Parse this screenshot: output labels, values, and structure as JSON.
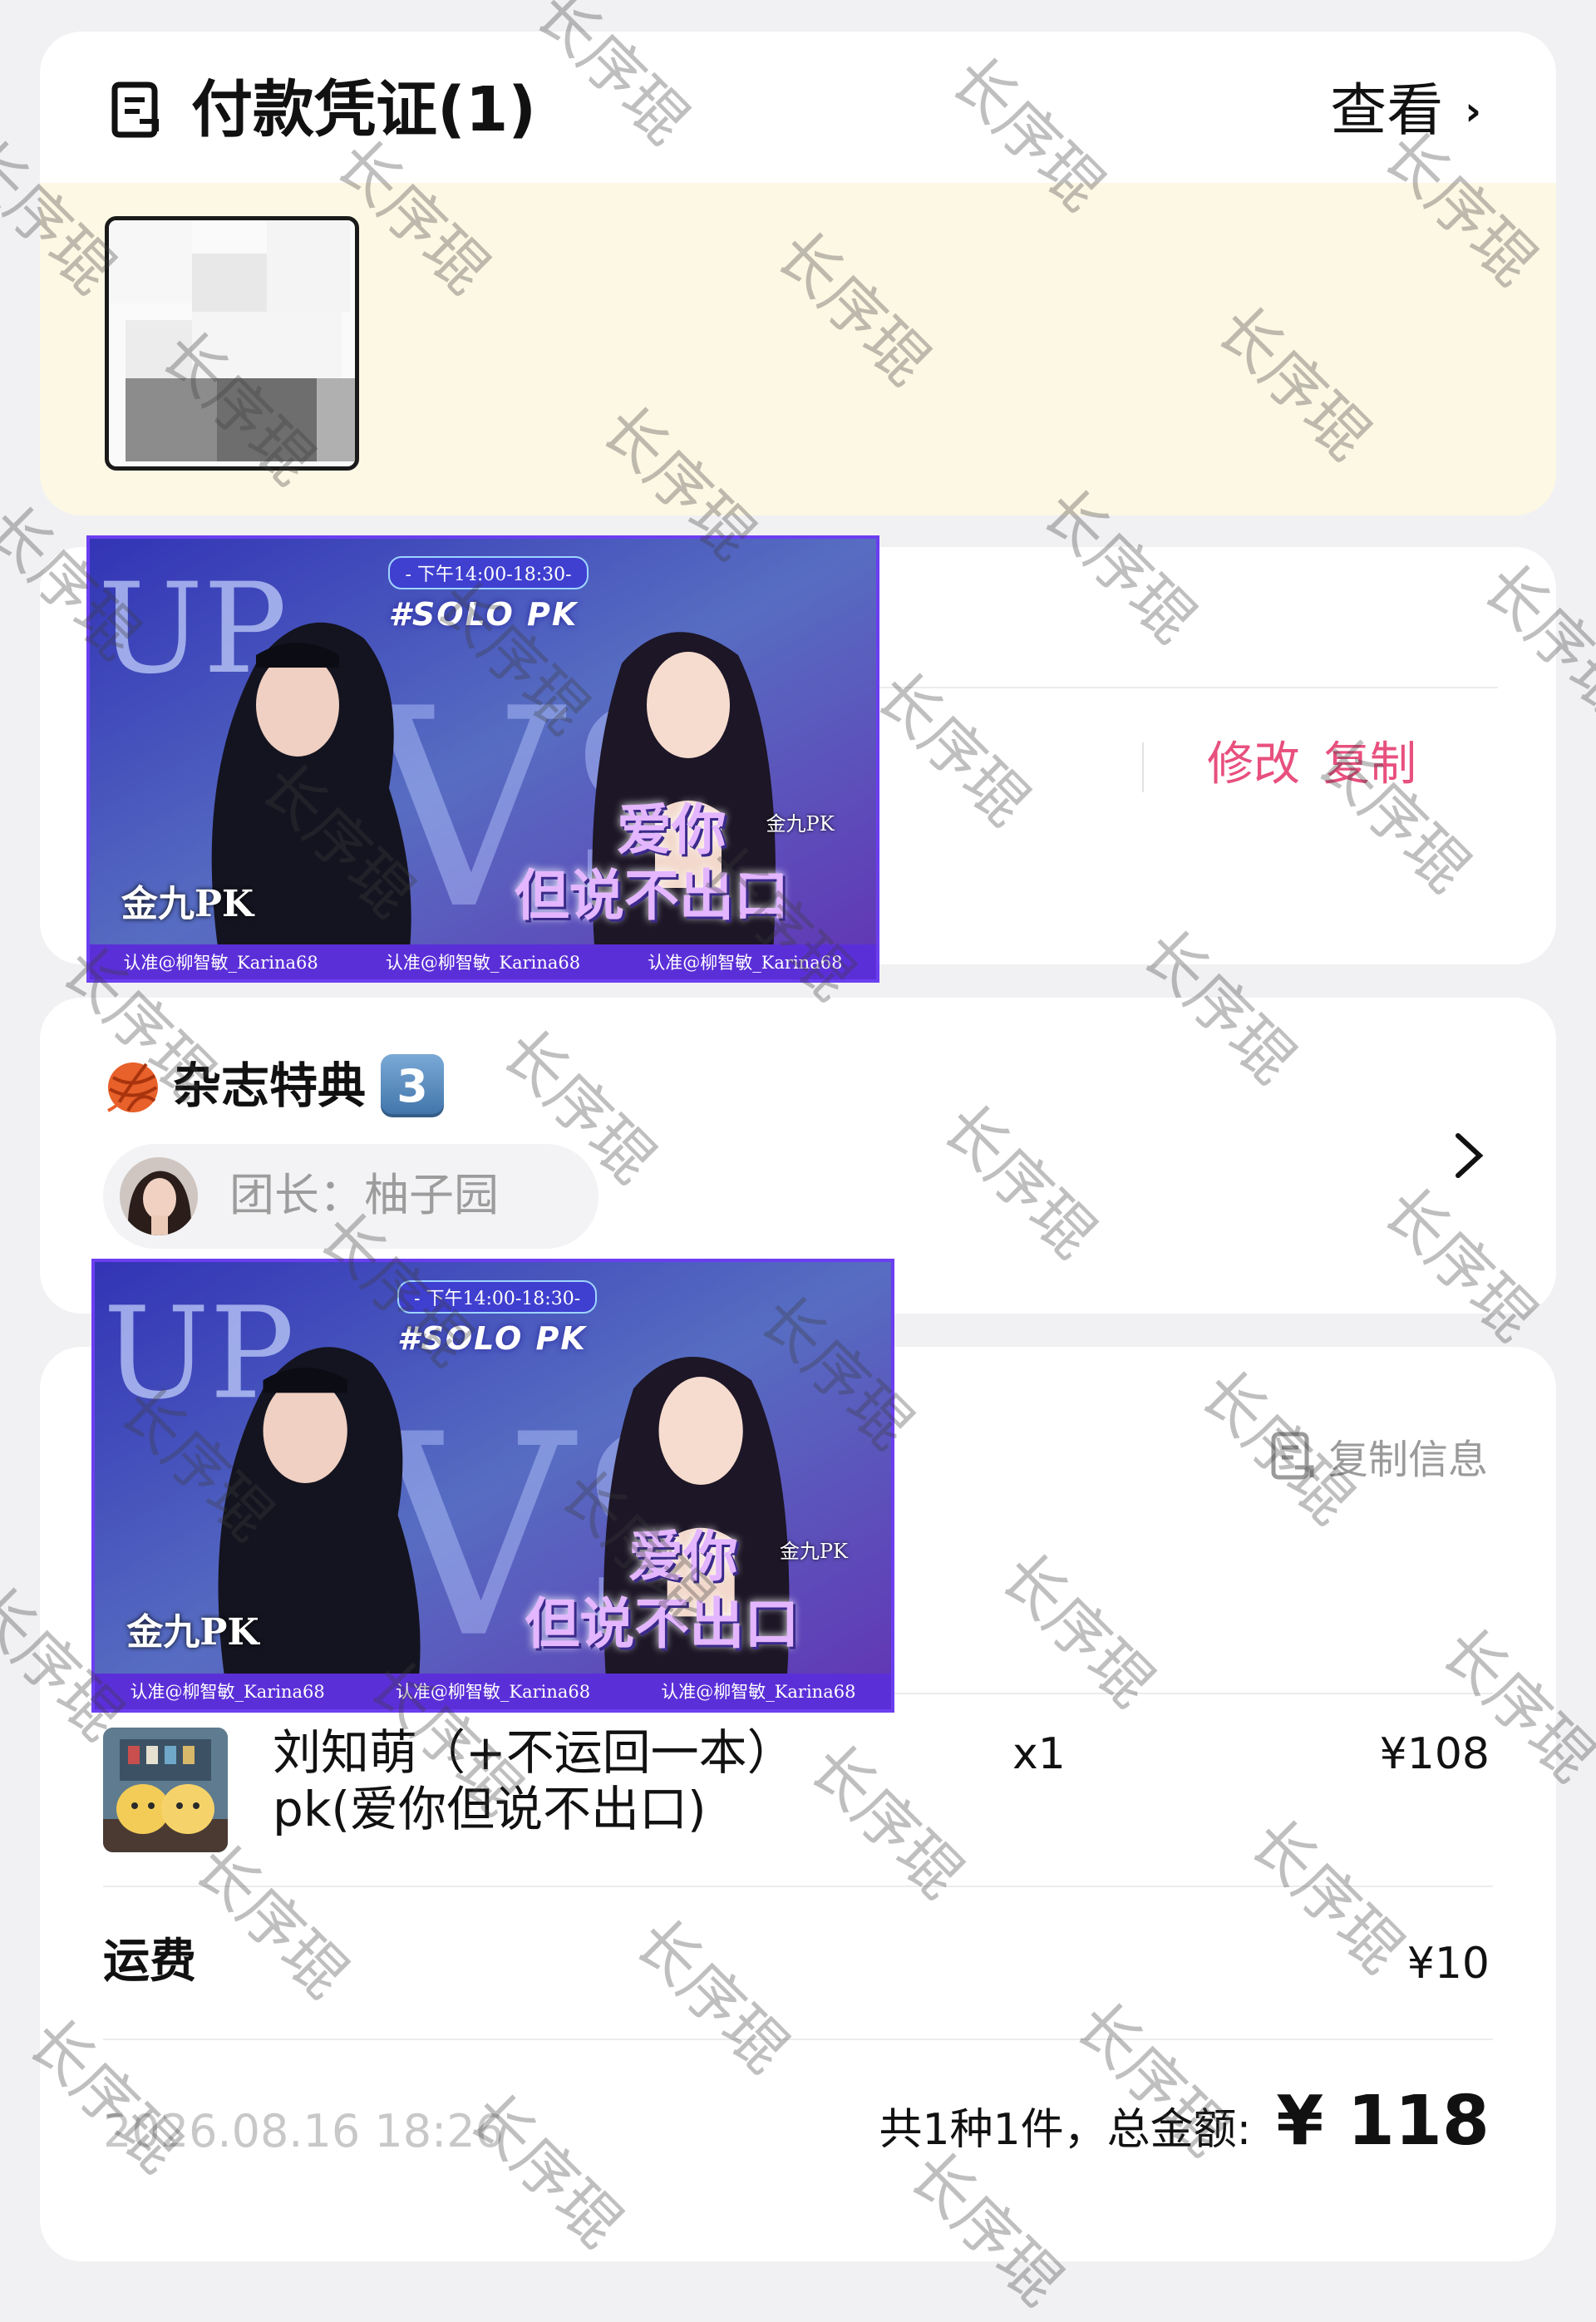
{
  "voucher": {
    "title": "付款凭证(1)",
    "view_label": "查看",
    "view_chevron": "›"
  },
  "address": {
    "edit_label": "修改",
    "copy_label": "复制"
  },
  "banner": {
    "time": "- 下午14:00-18:30-",
    "solo": "#SOLO PK",
    "left_title": "金九PK",
    "right_tag": "金九PK",
    "line1": "爱你",
    "line2": "但说不出口",
    "footer": [
      "认准@柳智敏_Karina68",
      "认准@柳智敏_Karina68",
      "认准@柳智敏_Karina68"
    ]
  },
  "group": {
    "title": "杂志特典",
    "badge": "3",
    "leader_text": "团长：柚子园"
  },
  "order": {
    "copy_info": "复制信息",
    "product_name": "刘知萌（+不运回一本）pk(爱你但说不出口)",
    "product_qty": "x1",
    "product_price": "¥108",
    "shipping_label": "运费",
    "shipping_value": "¥10",
    "timestamp": "2026.08.16 18:26",
    "total_label": "共1种1件，总金额:",
    "total_amount": "¥ 118"
  },
  "watermark": {
    "text": "长序琨"
  },
  "colors": {
    "accent_pink": "#e8507e",
    "voucher_bg": "#fdf8e4",
    "page_bg": "#f1f1f3"
  }
}
